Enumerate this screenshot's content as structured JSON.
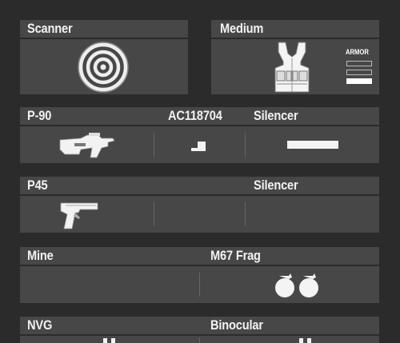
{
  "scanner": {
    "label": "Scanner",
    "icon": "target-icon"
  },
  "vest": {
    "label": "Medium",
    "icon": "armor-vest-icon",
    "armor_label": "ARMOR",
    "armor_levels_total": 3,
    "armor_levels_filled": 1
  },
  "primary": {
    "weapon": "P-90",
    "sight": "AC118704",
    "attachment": "Silencer",
    "weapon_icon": "smg-icon",
    "sight_icon": "red-dot-sight-icon",
    "attachment_icon": "silencer-icon"
  },
  "secondary": {
    "weapon": "P45",
    "attachment": "Silencer",
    "weapon_icon": "pistol-icon"
  },
  "equipment": {
    "slot1": "Mine",
    "slot2": "M67 Frag",
    "slot2_icon": "frag-grenade-icon"
  },
  "vision": {
    "slot1": "NVG",
    "slot2": "Binocular"
  }
}
